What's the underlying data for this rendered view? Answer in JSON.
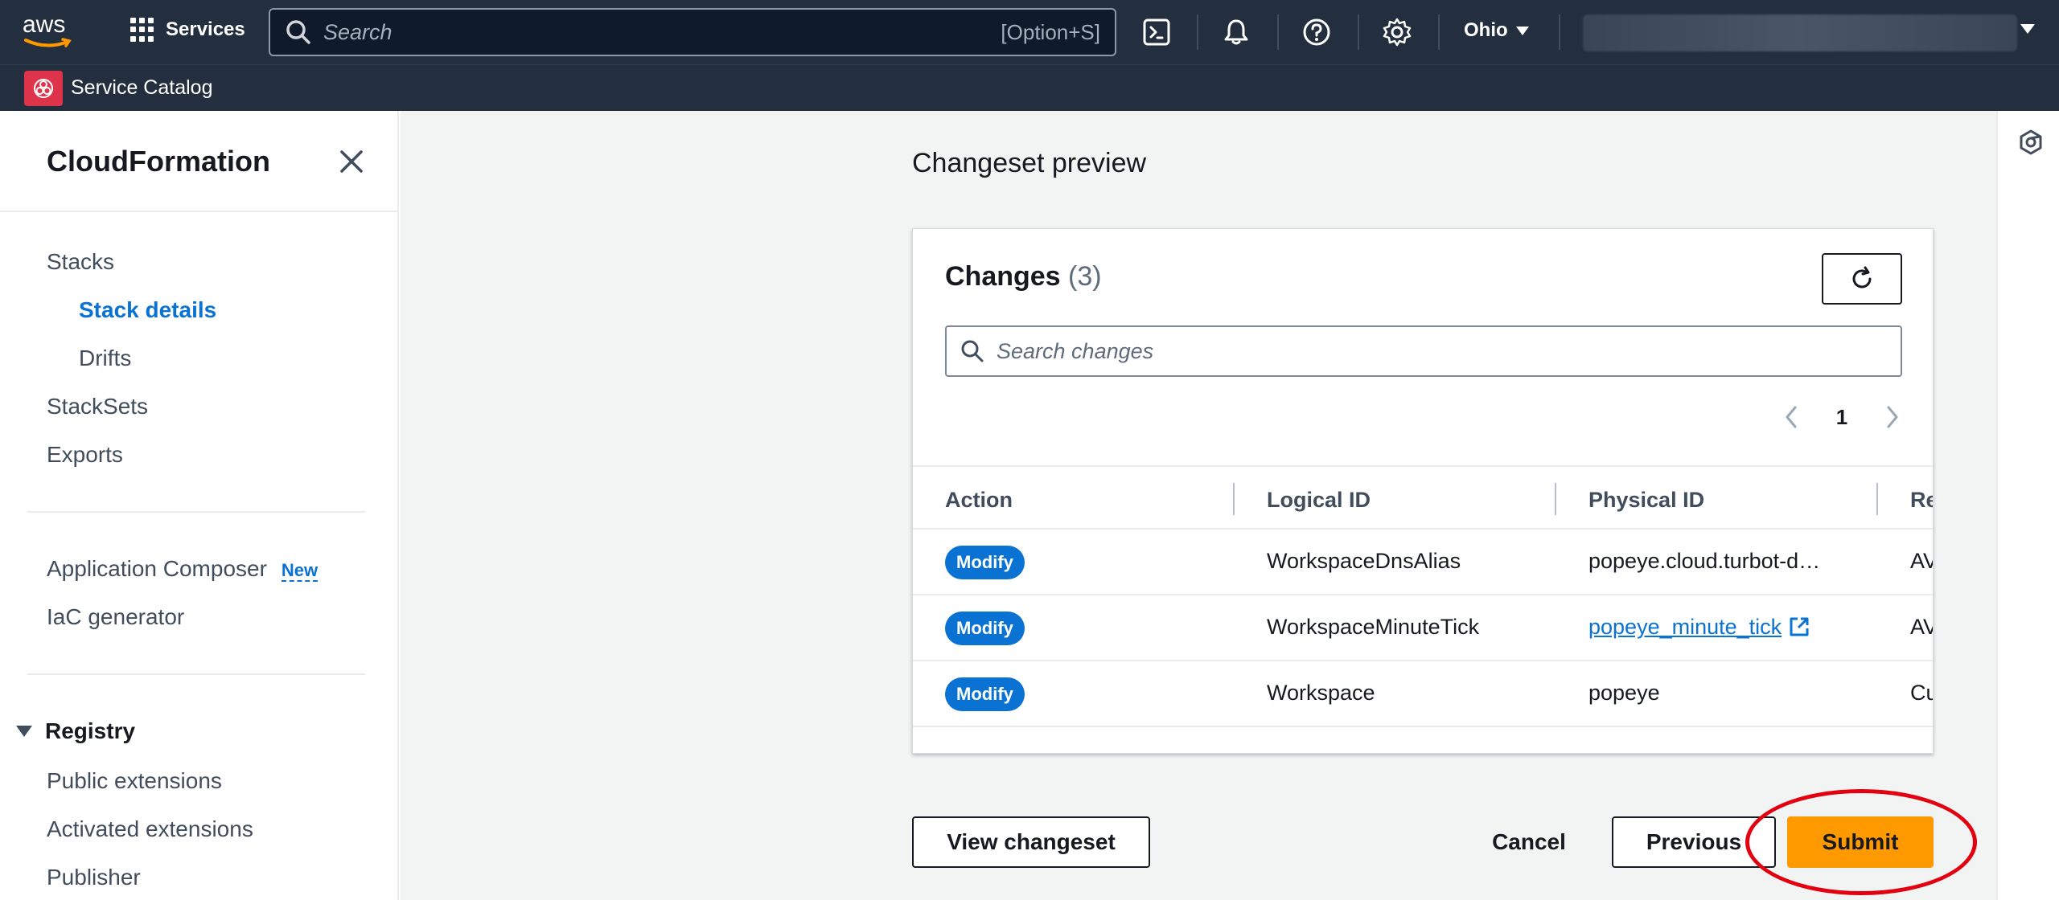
{
  "topnav": {
    "logo_text": "aws",
    "services_label": "Services",
    "search_placeholder": "Search",
    "search_shortcut": "[Option+S]",
    "region": "Ohio"
  },
  "subnav": {
    "service_label": "Service Catalog"
  },
  "sidebar": {
    "title": "CloudFormation",
    "items": [
      {
        "label": "Stacks"
      },
      {
        "label": "Stack details"
      },
      {
        "label": "Drifts"
      },
      {
        "label": "StackSets"
      },
      {
        "label": "Exports"
      },
      {
        "label": "Application Composer",
        "badge": "New"
      },
      {
        "label": "IaC generator"
      }
    ],
    "registry": {
      "label": "Registry",
      "items": [
        {
          "label": "Public extensions"
        },
        {
          "label": "Activated extensions"
        },
        {
          "label": "Publisher"
        }
      ]
    }
  },
  "main": {
    "page_heading": "Changeset preview",
    "changes": {
      "title": "Changes",
      "count": "(3)",
      "search_placeholder": "Search changes",
      "current_page": "1",
      "columns": [
        "Action",
        "Logical ID",
        "Physical ID",
        "Re"
      ],
      "rows": [
        {
          "action": "Modify",
          "logical_id": "WorkspaceDnsAlias",
          "physical_id": "popeye.cloud.turbot-d…",
          "resource": "AV"
        },
        {
          "action": "Modify",
          "logical_id": "WorkspaceMinuteTick",
          "physical_id": "popeye_minute_tick",
          "resource": "AV"
        },
        {
          "action": "Modify",
          "logical_id": "Workspace",
          "physical_id": "popeye",
          "resource": "Cu"
        }
      ]
    },
    "buttons": {
      "view_changeset": "View changeset",
      "cancel": "Cancel",
      "previous": "Previous",
      "submit": "Submit"
    }
  },
  "colors": {
    "nav_bg": "#232f3e",
    "link": "#0972d3",
    "primary": "#ff9900",
    "highlight": "#e3000f"
  }
}
